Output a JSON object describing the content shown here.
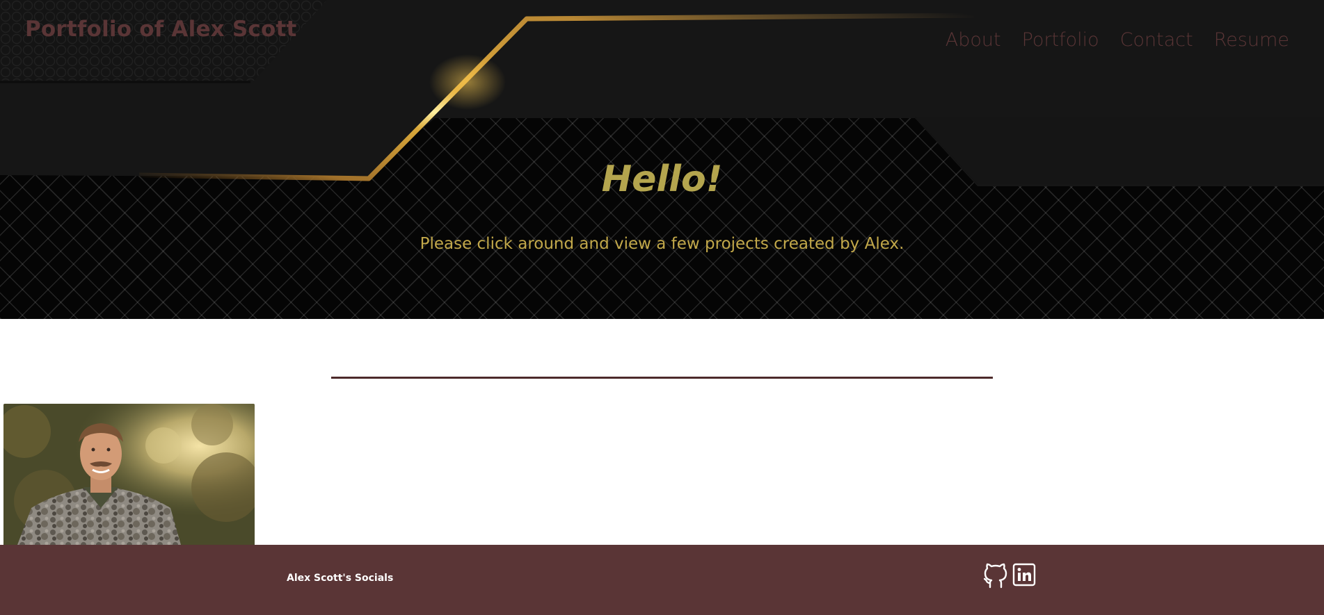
{
  "header": {
    "site_title": "Portfolio of Alex Scott",
    "nav": [
      {
        "label": "About"
      },
      {
        "label": "Portfolio"
      },
      {
        "label": "Contact"
      },
      {
        "label": "Resume"
      }
    ]
  },
  "hero": {
    "heading": "Hello!",
    "subtext": "Please click around and view a few projects created by Alex."
  },
  "footer": {
    "title": "Alex Scott's Socials",
    "socials": [
      {
        "icon": "github-icon"
      },
      {
        "icon": "linkedin-icon"
      }
    ]
  },
  "colors": {
    "brand_maroon": "#5a3536",
    "gold": "#c2a84a",
    "hero_dark": "#050505"
  }
}
